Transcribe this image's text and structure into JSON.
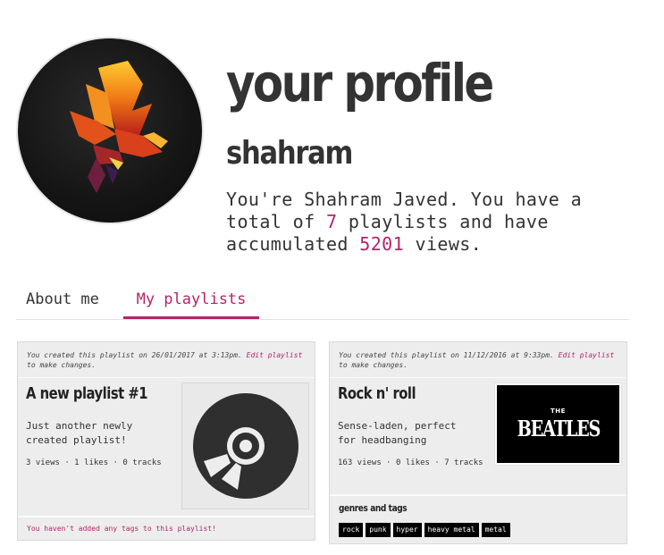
{
  "header": {
    "title": "your profile",
    "username": "shahram",
    "summary_pre": "You're Shahram Javed. You have a total of ",
    "playlist_count": "7",
    "summary_mid": " playlists and have accumulated ",
    "view_count": "5201",
    "summary_post": " views.",
    "avatar_icon": "phoenix-bird-icon"
  },
  "tabs": [
    {
      "label": "About me",
      "active": false
    },
    {
      "label": "My playlists",
      "active": true
    }
  ],
  "colors": {
    "accent": "#b3246b",
    "card_bg": "#ededed",
    "tag_bg": "#000000"
  },
  "playlists": [
    {
      "meta_pre": "You created this playlist on 26/01/2017 at 3:13pm. ",
      "edit_link": "Edit playlist",
      "meta_post": " to make changes.",
      "title": "A new playlist #1",
      "description": "Just another newly created playlist!",
      "stats": "3 views · 1 likes · 0 tracks",
      "cover_icon": "vinyl-disc-icon",
      "no_tags": "You haven't added any tags to this playlist!"
    },
    {
      "meta_pre": "You created this playlist on 11/12/2016 at 9:33pm. ",
      "edit_link": "Edit playlist",
      "meta_post": " to make changes.",
      "title": "Rock n' roll",
      "description": "Sense-laden, perfect for headbanging",
      "stats": "163 views · 0 likes · 7 tracks",
      "cover_the": "THE",
      "cover_name": "BEATLES",
      "genres_title": "genres and tags",
      "tags": [
        "rock",
        "punk",
        "hyper",
        "heavy metal",
        "metal"
      ]
    }
  ]
}
